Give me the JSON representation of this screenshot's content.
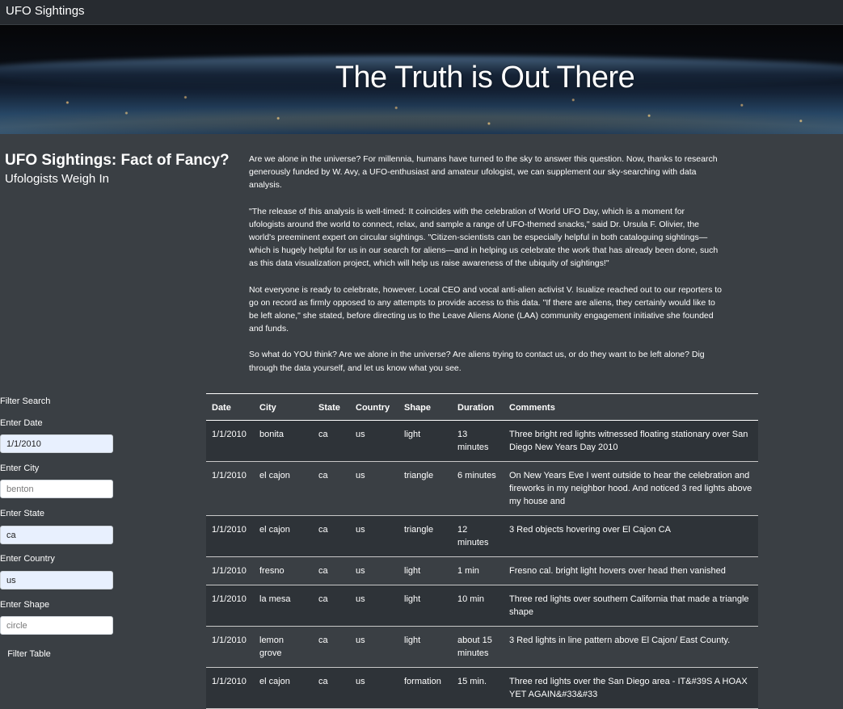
{
  "navbar": {
    "brand": "UFO Sightings"
  },
  "hero": {
    "title": "The Truth is Out There"
  },
  "sidebar": {
    "heading": "UFO Sightings: Fact of Fancy?",
    "subheading": "Ufologists Weigh In"
  },
  "article": {
    "paragraphs": [
      "Are we alone in the universe? For millennia, humans have turned to the sky to answer this question. Now, thanks to research generously funded by W. Avy, a UFO-enthusiast and amateur ufologist, we can supplement our sky-searching with data analysis.",
      "\"The release of this analysis is well-timed: It coincides with the celebration of World UFO Day, which is a moment for ufologists around the world to connect, relax, and sample a range of UFO-themed snacks,\" said Dr. Ursula F. Olivier, the world's preeminent expert on circular sightings. \"Citizen-scientists can be especially helpful in both cataloguing sightings—which is hugely helpful for us in our search for aliens—and in helping us celebrate the work that has already been done, such as this data visualization project, which will help us raise awareness of the ubiquity of sightings!\"",
      "Not everyone is ready to celebrate, however. Local CEO and vocal anti-alien activist V. Isualize reached out to our reporters to go on record as firmly opposed to any attempts to provide access to this data. \"If there are aliens, they certainly would like to be left alone,\" she stated, before directing us to the Leave Aliens Alone (LAA) community engagement initiative she founded and funds.",
      "So what do YOU think? Are we alone in the universe? Are aliens trying to contact us, or do they want to be left alone? Dig through the data yourself, and let us know what you see."
    ]
  },
  "filters": {
    "title": "Filter Search",
    "date": {
      "label": "Enter Date",
      "value": "1/1/2010",
      "placeholder": "1/1/2010"
    },
    "city": {
      "label": "Enter City",
      "value": "",
      "placeholder": "benton"
    },
    "state": {
      "label": "Enter State",
      "value": "ca",
      "placeholder": "ca"
    },
    "country": {
      "label": "Enter Country",
      "value": "us",
      "placeholder": "us"
    },
    "shape": {
      "label": "Enter Shape",
      "value": "",
      "placeholder": "circle"
    },
    "button": "Filter Table"
  },
  "table": {
    "headers": [
      "Date",
      "City",
      "State",
      "Country",
      "Shape",
      "Duration",
      "Comments"
    ],
    "rows": [
      [
        "1/1/2010",
        "bonita",
        "ca",
        "us",
        "light",
        "13 minutes",
        "Three bright red lights witnessed floating stationary over San Diego New Years Day 2010"
      ],
      [
        "1/1/2010",
        "el cajon",
        "ca",
        "us",
        "triangle",
        "6 minutes",
        "On New Years Eve I went outside to hear the celebration and fireworks in my neighbor hood. And noticed 3 red lights above my house and"
      ],
      [
        "1/1/2010",
        "el cajon",
        "ca",
        "us",
        "triangle",
        "12 minutes",
        "3 Red objects hovering over El Cajon CA"
      ],
      [
        "1/1/2010",
        "fresno",
        "ca",
        "us",
        "light",
        "1 min",
        "Fresno cal. bright light hovers over head then vanished"
      ],
      [
        "1/1/2010",
        "la mesa",
        "ca",
        "us",
        "light",
        "10 min",
        "Three red lights over southern California that made a triangle shape"
      ],
      [
        "1/1/2010",
        "lemon grove",
        "ca",
        "us",
        "light",
        "about 15 minutes",
        "3 Red lights in line pattern above El Cajon/ East County."
      ],
      [
        "1/1/2010",
        "el cajon",
        "ca",
        "us",
        "formation",
        "15 min.",
        "Three red lights over the San Diego area - IT&#39S A HOAX YET AGAIN&#33&#33"
      ]
    ]
  }
}
